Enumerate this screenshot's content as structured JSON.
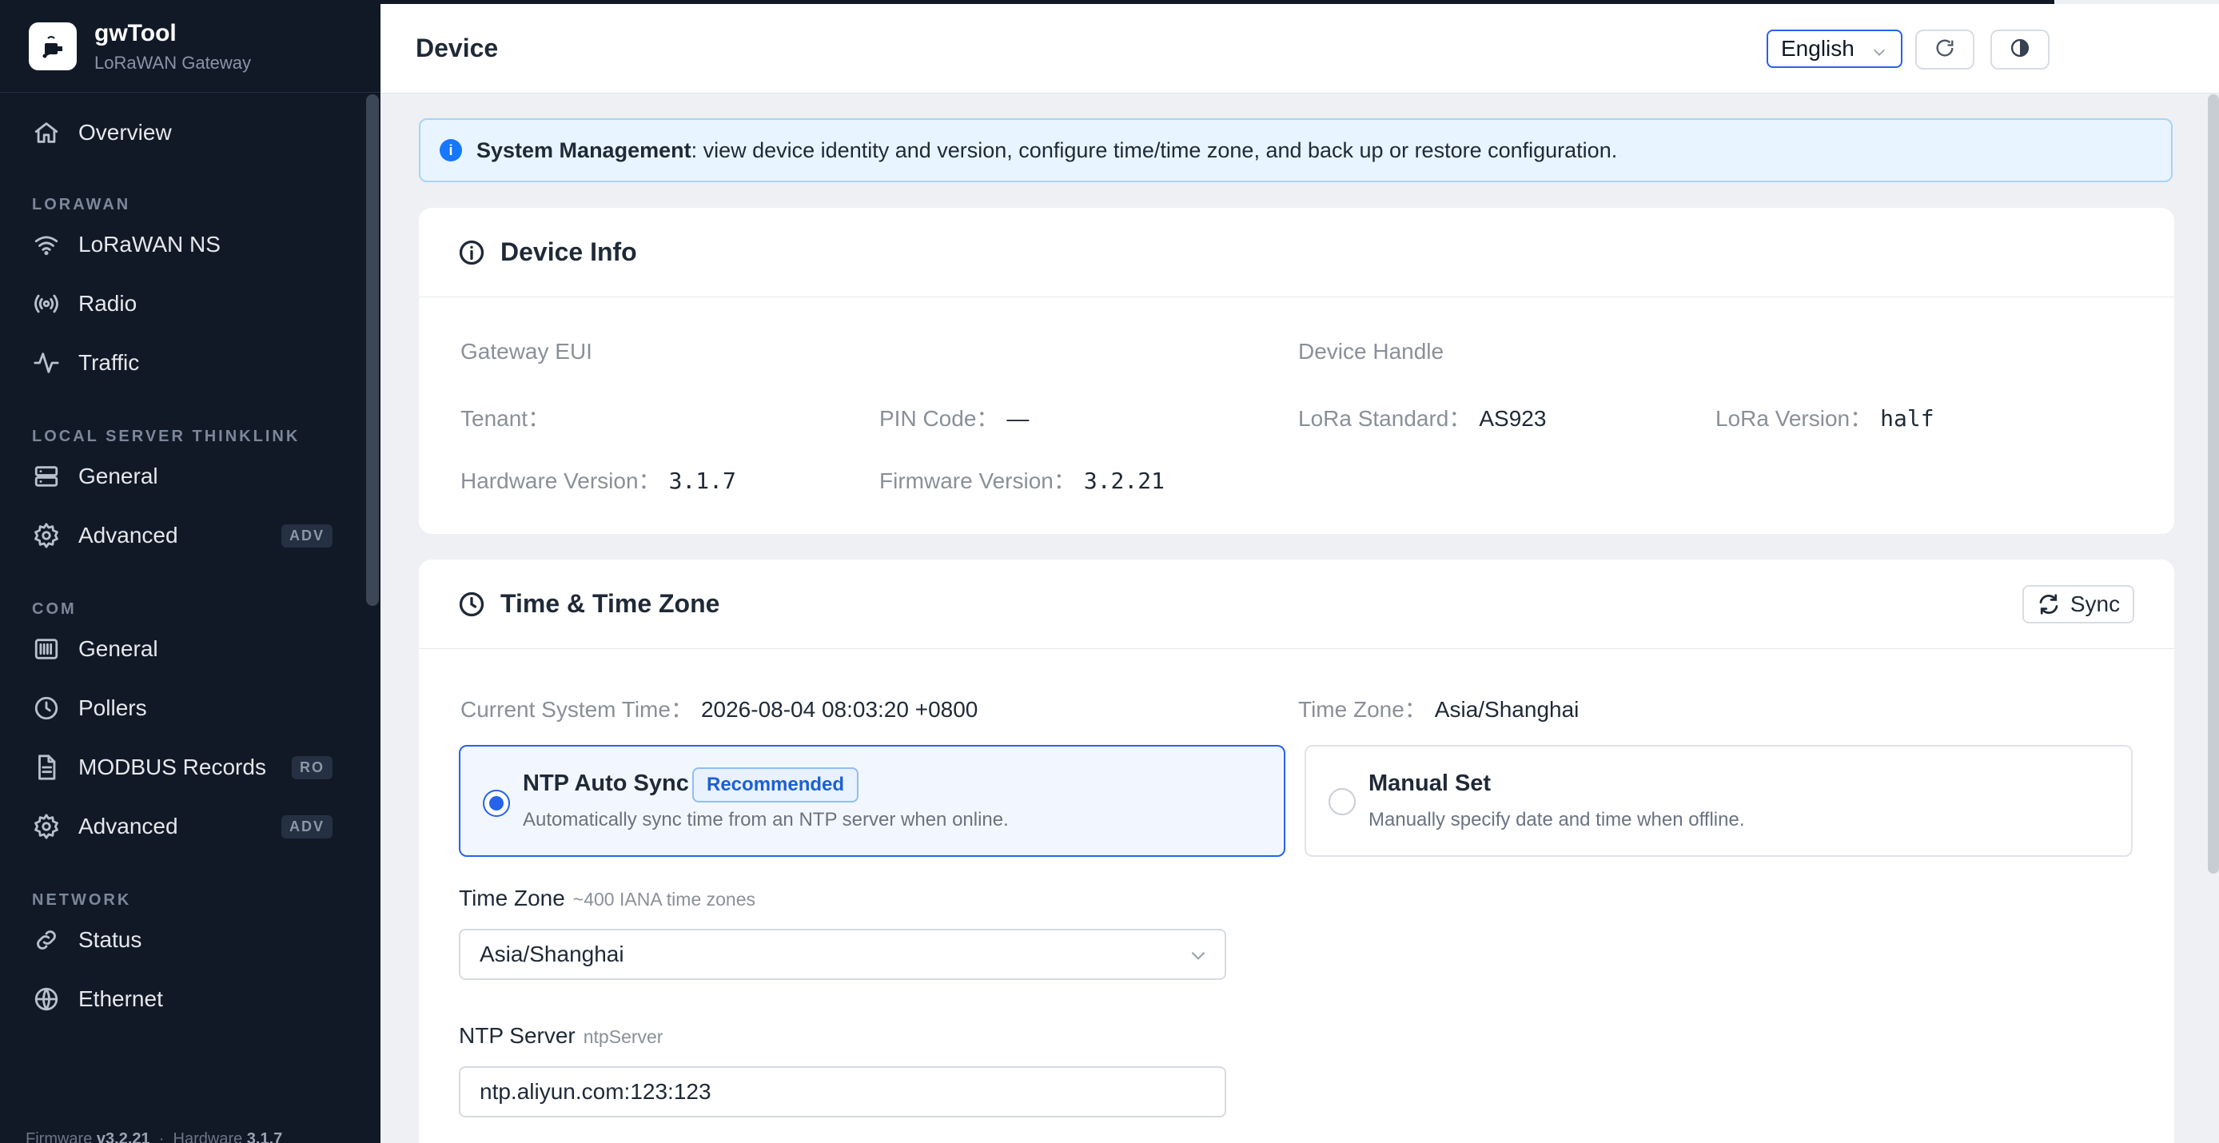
{
  "brand": {
    "title": "gwTool",
    "subtitle": "LoRaWAN Gateway"
  },
  "sidebar": {
    "items": [
      {
        "label": "Overview"
      },
      {
        "label": "LoRaWAN NS"
      },
      {
        "label": "Radio"
      },
      {
        "label": "Traffic"
      },
      {
        "label": "General"
      },
      {
        "label": "Advanced",
        "badge": "ADV"
      },
      {
        "label": "General"
      },
      {
        "label": "Pollers"
      },
      {
        "label": "MODBUS Records",
        "badge": "RO"
      },
      {
        "label": "Advanced",
        "badge": "ADV"
      },
      {
        "label": "Status"
      },
      {
        "label": "Ethernet"
      }
    ],
    "sections": [
      "LORAWAN",
      "LOCAL SERVER THINKLINK",
      "COM",
      "NETWORK"
    ],
    "footer": {
      "fw_label": "Firmware",
      "fw_value": "v3.2.21",
      "hw_label": "Hardware",
      "hw_value": "3.1.7"
    }
  },
  "header": {
    "title": "Device",
    "language": "English"
  },
  "alert": {
    "title": "System Management",
    "text": ": view device identity and version, configure time/time zone, and back up or restore configuration."
  },
  "device_info": {
    "title": "Device Info",
    "gateway_eui_label": "Gateway EUI",
    "device_handle_label": "Device Handle",
    "tenant_label": "Tenant：",
    "pin_label": "PIN Code：",
    "pin_value": "—",
    "lora_standard_label": "LoRa Standard：",
    "lora_standard_value": "AS923",
    "lora_version_label": "LoRa Version：",
    "lora_version_value": "half",
    "hw_label": "Hardware Version：",
    "hw_value": "3.1.7",
    "fw_label": "Firmware Version：",
    "fw_value": "3.2.21"
  },
  "time_zone": {
    "title": "Time & Time Zone",
    "sync_label": "Sync",
    "current_time_label": "Current System Time：",
    "current_time_value": "2026-08-04 08:03:20 +0800",
    "tz_label": "Time Zone：",
    "tz_value": "Asia/Shanghai",
    "ntp_option": {
      "title": "NTP Auto Sync",
      "badge": "Recommended",
      "desc": "Automatically sync time from an NTP server when online."
    },
    "manual_option": {
      "title": "Manual Set",
      "desc": "Manually specify date and time when offline."
    },
    "tz_field_label": "Time Zone",
    "tz_field_hint": "~400 IANA time zones",
    "tz_field_value": "Asia/Shanghai",
    "ntp_field_label": "NTP Server",
    "ntp_field_hint": "ntpServer",
    "ntp_field_value": "ntp.aliyun.com:123:123"
  },
  "colors": {
    "accent": "#2563eb",
    "sidebar_bg": "#111927",
    "info_bg": "#e8f4ff"
  }
}
